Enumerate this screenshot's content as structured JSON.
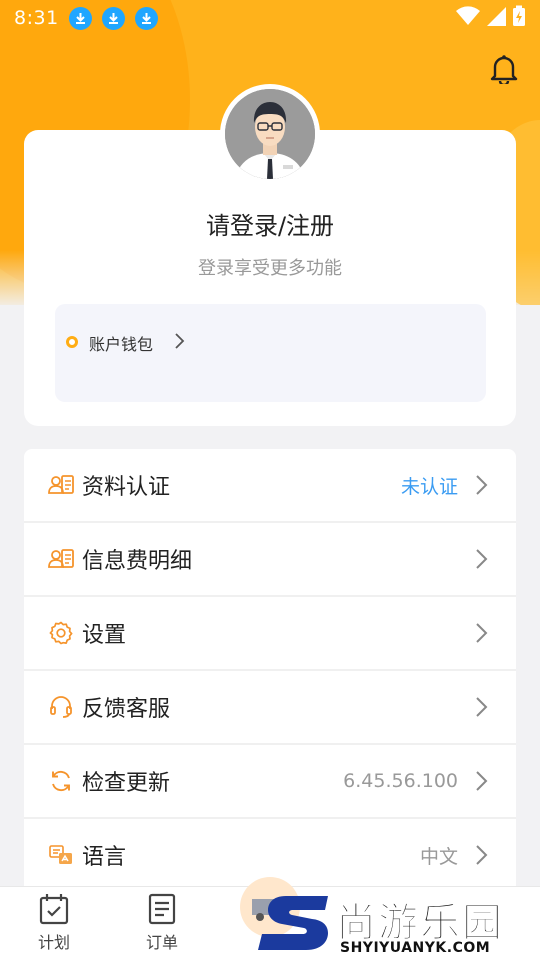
{
  "status_bar": {
    "time": "8:31",
    "icons": [
      "download-icon",
      "download-icon",
      "download-icon",
      "wifi-icon",
      "cell-signal-icon",
      "battery-charging-icon"
    ]
  },
  "header": {
    "bell_icon": "bell-icon"
  },
  "profile": {
    "title": "请登录/注册",
    "subtitle": "登录享受更多功能",
    "wallet_label": "账户钱包"
  },
  "menu": {
    "items": [
      {
        "label": "资料认证",
        "value": "未认证",
        "icon": "id-card-icon"
      },
      {
        "label": "信息费明细",
        "value": "",
        "icon": "id-card-icon"
      },
      {
        "label": "设置",
        "value": "",
        "icon": "gear-icon"
      },
      {
        "label": "反馈客服",
        "value": "",
        "icon": "headset-icon"
      },
      {
        "label": "检查更新",
        "value": "6.45.56.100",
        "icon": "refresh-icon"
      },
      {
        "label": "语言",
        "value": "中文",
        "icon": "language-icon"
      }
    ]
  },
  "tabbar": {
    "tabs": [
      {
        "label": "计划",
        "icon": "calendar-check-icon"
      },
      {
        "label": "订单",
        "icon": "document-icon"
      }
    ]
  },
  "watermark": {
    "title": "尚游乐园",
    "url": "SHYIYUANYK.COM"
  },
  "colors": {
    "brand": "#ffb21b",
    "accent_blue": "#3b9cf2",
    "icon_orange": "#f5942c"
  }
}
